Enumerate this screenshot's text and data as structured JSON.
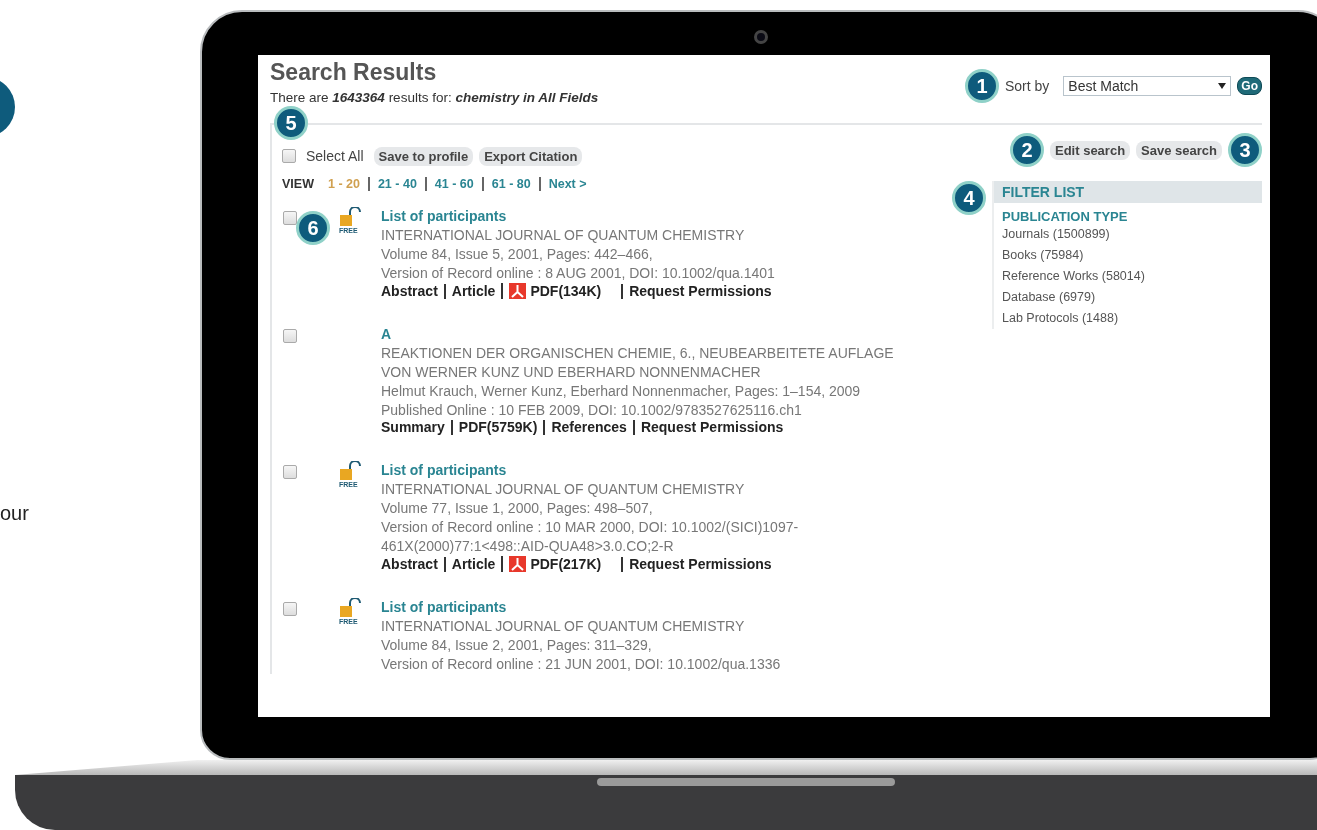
{
  "side_text": "our",
  "page": {
    "title": "Search Results",
    "summary": {
      "prefix": "There are",
      "count": "1643364",
      "middle": "results for:",
      "query": "chemistry in All Fields"
    },
    "sort": {
      "marker": "1",
      "label": "Sort by",
      "value": "Best Match",
      "go": "Go"
    },
    "toolbar": {
      "marker": "5",
      "select_all": {
        "label": "Select All",
        "checked": false
      },
      "buttons": [
        "Save to profile",
        "Export Citation"
      ],
      "right_buttons": [
        {
          "label": "Edit search",
          "marker": "2"
        },
        {
          "label": "Save search",
          "marker": "3"
        }
      ]
    },
    "pagination": {
      "label": "VIEW",
      "pages": [
        {
          "label": "1 - 20",
          "selected": true
        },
        {
          "label": "21 - 40",
          "selected": false
        },
        {
          "label": "41 - 60",
          "selected": false
        },
        {
          "label": "61 - 80",
          "selected": false
        }
      ],
      "next": "Next >"
    },
    "results": [
      {
        "checked": false,
        "marker": "6",
        "badge": "FREE",
        "title": "List of participants",
        "lines": [
          "INTERNATIONAL JOURNAL OF QUANTUM CHEMISTRY",
          "Volume 84, Issue 5, 2001, Pages: 442–466,",
          "Version of Record online : 8 AUG 2001, DOI: 10.1002/qua.1401"
        ],
        "links": [
          {
            "label": "Abstract",
            "kind": "text"
          },
          {
            "label": "Article",
            "kind": "text"
          },
          {
            "label": "PDF(134K)",
            "kind": "pdf"
          },
          {
            "label": "Request Permissions",
            "kind": "text"
          }
        ]
      },
      {
        "checked": false,
        "title": "A",
        "lines": [
          "REAKTIONEN DER ORGANISCHEN CHEMIE, 6., NEUBEARBEITETE AUFLAGE",
          "VON WERNER KUNZ UND EBERHARD NONNENMACHER",
          "Helmut Krauch, Werner Kunz, Eberhard Nonnenmacher, Pages: 1–154, 2009",
          "Published Online : 10 FEB 2009, DOI: 10.1002/9783527625116.ch1"
        ],
        "links": [
          {
            "label": "Summary",
            "kind": "text"
          },
          {
            "label": "PDF(5759K)",
            "kind": "text"
          },
          {
            "label": "References",
            "kind": "text"
          },
          {
            "label": "Request Permissions",
            "kind": "text"
          }
        ]
      },
      {
        "checked": false,
        "badge": "FREE",
        "title": "List of participants",
        "lines": [
          "INTERNATIONAL JOURNAL OF QUANTUM CHEMISTRY",
          "Volume 77, Issue 1, 2000, Pages: 498–507,",
          "Version of Record online : 10 MAR 2000, DOI: 10.1002/(SICI)1097-",
          "461X(2000)77:1<498::AID-QUA48>3.0.CO;2-R"
        ],
        "links": [
          {
            "label": "Abstract",
            "kind": "text"
          },
          {
            "label": "Article",
            "kind": "text"
          },
          {
            "label": "PDF(217K)",
            "kind": "pdf"
          },
          {
            "label": "Request Permissions",
            "kind": "text"
          }
        ]
      },
      {
        "checked": false,
        "badge": "FREE",
        "title": "List of participants",
        "lines": [
          "INTERNATIONAL JOURNAL OF QUANTUM CHEMISTRY",
          "Volume 84, Issue 2, 2001, Pages: 311–329,",
          "Version of Record online : 21 JUN 2001, DOI: 10.1002/qua.1336"
        ]
      }
    ],
    "filter": {
      "marker": "4",
      "title": "FILTER LIST",
      "section": "PUBLICATION TYPE",
      "items": [
        "Journals (1500899)",
        "Books (75984)",
        "Reference Works (58014)",
        "Database (6979)",
        "Lab Protocols (1488)"
      ]
    }
  }
}
